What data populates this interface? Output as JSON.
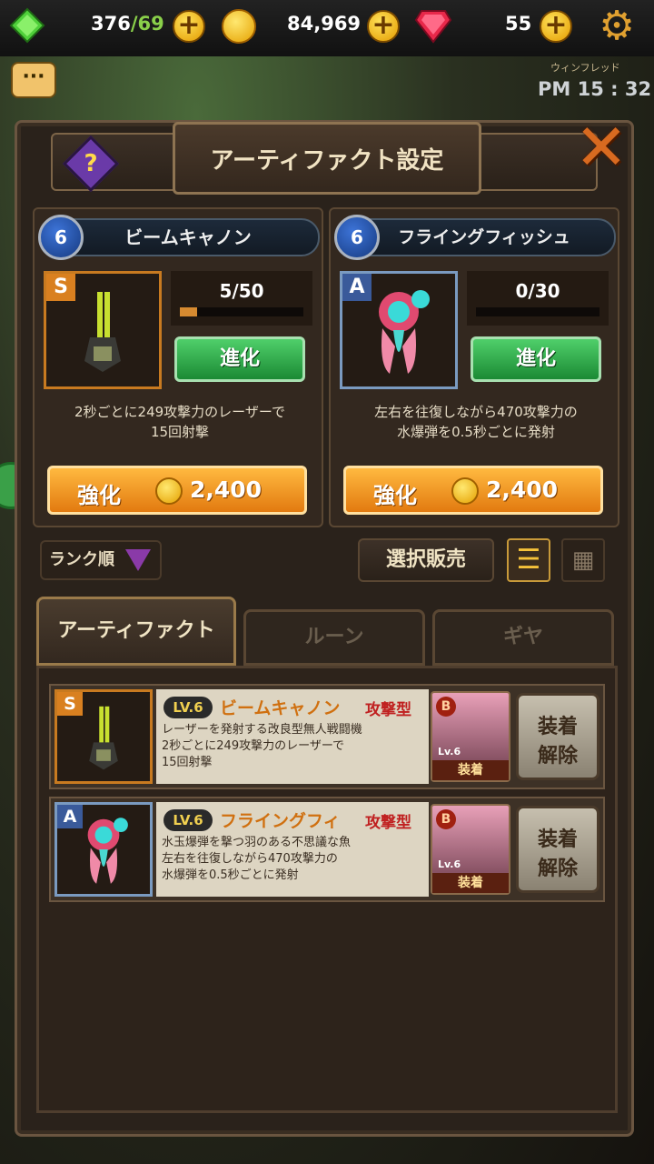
{
  "topbar": {
    "stamina": "376",
    "stamina_max": "/69",
    "gold": "84,969",
    "gems": "55",
    "icons": {
      "stamina": "green-gem-icon",
      "gold": "gold-coin-icon",
      "gems": "ruby-icon",
      "settings": "gear-icon",
      "chat": "chat-icon"
    }
  },
  "clock": {
    "caption": "ウィンフレッド",
    "time": "PM 15 : 32"
  },
  "dialog": {
    "title": "アーティファクト設定"
  },
  "equipped": [
    {
      "level": "6",
      "name": "ビームキャノン",
      "rank": "S",
      "progress": "5/50",
      "progress_fraction": 0.1,
      "evolve_label": "進化",
      "desc_line1": "2秒ごとに249攻撃力のレーザーで",
      "desc_line2": "15回射撃",
      "upgrade_label": "強化",
      "upgrade_cost": "2,400"
    },
    {
      "level": "6",
      "name": "フライングフィッシュ",
      "rank": "A",
      "progress": "0/30",
      "progress_fraction": 0.0,
      "evolve_label": "進化",
      "desc_line1": "左右を往復しながら470攻撃力の",
      "desc_line2": "水爆弾を0.5秒ごとに発射",
      "upgrade_label": "強化",
      "upgrade_cost": "2,400"
    }
  ],
  "filter": {
    "sort_label": "ランク順",
    "sell_label": "選択販売"
  },
  "tabs": [
    {
      "label": "アーティファクト",
      "active": true
    },
    {
      "label": "ルーン",
      "active": false
    },
    {
      "label": "ギヤ",
      "active": false
    }
  ],
  "list": [
    {
      "rank": "S",
      "level": "LV.6",
      "name": "ビームキャノン",
      "type": "攻撃型",
      "desc": [
        "レーザーを発射する改良型無人戦闘機",
        "2秒ごとに249攻撃力のレーザーで",
        "15回射撃"
      ],
      "hero_rank": "B",
      "hero_level": "Lv.6",
      "hero_tag": "装着",
      "unequip_line1": "装着",
      "unequip_line2": "解除"
    },
    {
      "rank": "A",
      "level": "LV.6",
      "name": "フライングフィ",
      "type": "攻撃型",
      "desc": [
        "水玉爆弾を撃つ羽のある不思議な魚",
        "左右を往復しながら470攻撃力の",
        "水爆弾を0.5秒ごとに発射"
      ],
      "hero_rank": "B",
      "hero_level": "Lv.6",
      "hero_tag": "装着",
      "unequip_line1": "装着",
      "unequip_line2": "解除"
    }
  ]
}
